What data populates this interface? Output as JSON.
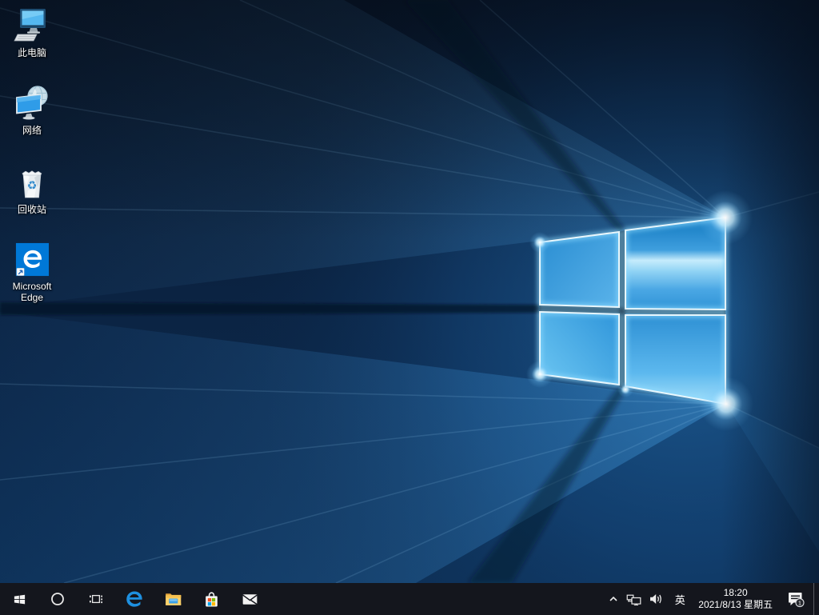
{
  "desktop": {
    "icons": [
      {
        "id": "this-pc",
        "label": "此电脑"
      },
      {
        "id": "network",
        "label": "网络"
      },
      {
        "id": "recycle-bin",
        "label": "回收站",
        "glyph": "♻"
      },
      {
        "id": "microsoft-edge",
        "label": "Microsoft Edge"
      }
    ]
  },
  "taskbar": {
    "buttons": [
      "start",
      "cortana-search",
      "task-view",
      "microsoft-edge",
      "file-explorer",
      "microsoft-store",
      "mail"
    ],
    "tray": {
      "hidden_icons_chevron": "show-hidden-icons",
      "network": "ethernet-network",
      "volume": "speaker",
      "ime_indicator": "英",
      "time": "18:20",
      "date": "2021/8/13 星期五",
      "notification_count": "1"
    }
  },
  "colors": {
    "taskbar_bg": "#14161d",
    "wallpaper_base": "#0a1f38",
    "accent_blue": "#0078d7",
    "edge_blue": "#1e90e0",
    "store_red": "#f25022",
    "store_green": "#7fba00",
    "store_blue": "#00a4ef",
    "store_yellow": "#ffb900"
  }
}
